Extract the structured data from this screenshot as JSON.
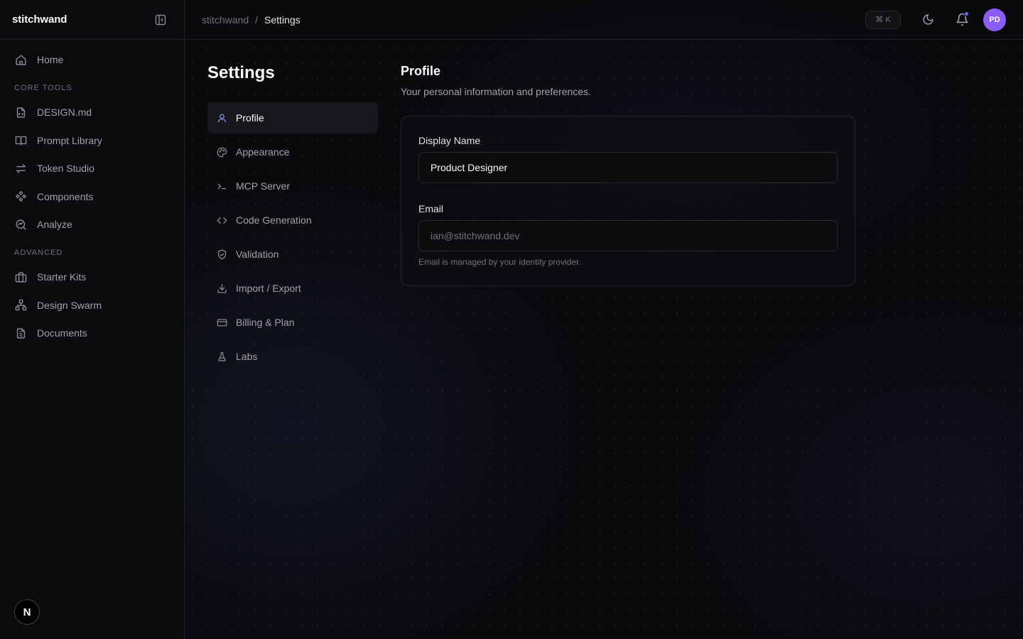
{
  "sidebar": {
    "brand": "stitchwand",
    "home": "Home",
    "core_section": "CORE TOOLS",
    "core_items": [
      {
        "label": "DESIGN.md",
        "icon": "file-code-icon"
      },
      {
        "label": "Prompt Library",
        "icon": "book-icon"
      },
      {
        "label": "Token Studio",
        "icon": "arrows-exchange-icon"
      },
      {
        "label": "Components",
        "icon": "component-icon"
      },
      {
        "label": "Analyze",
        "icon": "search-chart-icon"
      }
    ],
    "advanced_section": "ADVANCED",
    "advanced_items": [
      {
        "label": "Starter Kits",
        "icon": "building-icon"
      },
      {
        "label": "Design Swarm",
        "icon": "network-icon"
      },
      {
        "label": "Documents",
        "icon": "document-icon"
      }
    ],
    "user_badge": "N"
  },
  "topbar": {
    "breadcrumb_root": "stitchwand",
    "breadcrumb_sep": "/",
    "breadcrumb_current": "Settings",
    "shortcut": "⌘ K",
    "avatar_initials": "PD",
    "accent": "#8b5cf6",
    "notif_color": "#6366f1"
  },
  "settings": {
    "title": "Settings",
    "nav": [
      {
        "label": "Profile",
        "icon": "user-icon",
        "active": true
      },
      {
        "label": "Appearance",
        "icon": "palette-icon"
      },
      {
        "label": "MCP Server",
        "icon": "terminal-icon"
      },
      {
        "label": "Code Generation",
        "icon": "code-icon"
      },
      {
        "label": "Validation",
        "icon": "shield-check-icon"
      },
      {
        "label": "Import / Export",
        "icon": "download-icon"
      },
      {
        "label": "Billing & Plan",
        "icon": "credit-card-icon"
      },
      {
        "label": "Labs",
        "icon": "flask-icon"
      }
    ]
  },
  "profile": {
    "title": "Profile",
    "description": "Your personal information and preferences.",
    "display_name_label": "Display Name",
    "display_name_value": "Product Designer",
    "email_label": "Email",
    "email_value": "ian@stitchwand.dev",
    "email_hint": "Email is managed by your identity provider."
  }
}
